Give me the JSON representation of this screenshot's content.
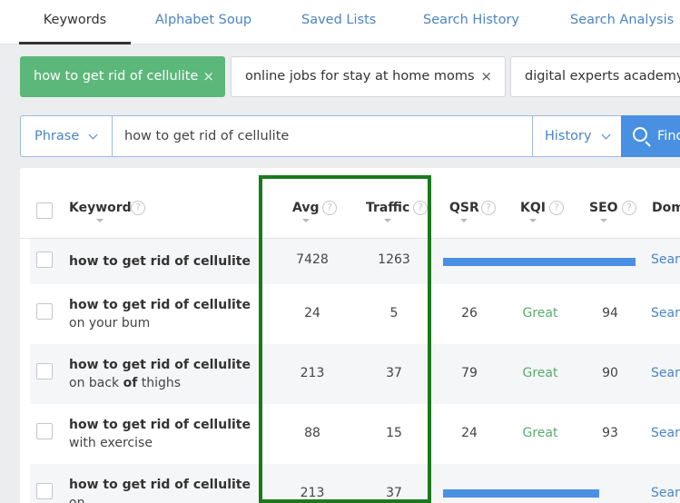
{
  "tabs": [
    {
      "label": "Keywords",
      "active": true
    },
    {
      "label": "Alphabet Soup"
    },
    {
      "label": "Saved Lists"
    },
    {
      "label": "Search History"
    },
    {
      "label": "Search Analysis"
    }
  ],
  "chips": [
    {
      "label": "how to get rid of cellulite",
      "close": "×",
      "active": true
    },
    {
      "label": "online jobs for stay at home moms",
      "close": "×"
    },
    {
      "label": "digital experts academy"
    }
  ],
  "search": {
    "mode_label": "Phrase",
    "value": "how to get rid of cellulite",
    "history_label": "History",
    "find_label": "Find"
  },
  "columns": {
    "keyword": "Keyword",
    "avg": "Avg",
    "traffic": "Traffic",
    "qsr": "QSR",
    "kqi": "KQI",
    "seo": "SEO",
    "domains": "Dom",
    "help": "?"
  },
  "rows": [
    {
      "kw_bold": "how to get rid of cellulite",
      "kw_rest": "",
      "kw_rest2": "",
      "avg": "7428",
      "traffic": "1263",
      "qsr": "",
      "kqi": "",
      "seo": "",
      "bar": 1.0,
      "link": "Search"
    },
    {
      "kw_bold": "how to get rid of cellulite",
      "kw_rest": " on your bum",
      "kw_rest2": "",
      "avg": "24",
      "traffic": "5",
      "qsr": "26",
      "kqi": "Great",
      "seo": "94",
      "link": "Search"
    },
    {
      "kw_bold": "how to get rid of cellulite",
      "kw_rest": " on back ",
      "kw_of": "of",
      "kw_rest2": " thighs",
      "avg": "213",
      "traffic": "37",
      "qsr": "79",
      "kqi": "Great",
      "seo": "90",
      "link": "Search"
    },
    {
      "kw_bold": "how to get rid of cellulite",
      "kw_rest": " with exercise",
      "kw_rest2": "",
      "avg": "88",
      "traffic": "15",
      "qsr": "24",
      "kqi": "Great",
      "seo": "93",
      "link": "Search"
    },
    {
      "kw_bold": "how to get rid of cellulite",
      "kw_rest": " on",
      "kw_rest2": "",
      "avg": "213",
      "traffic": "37",
      "qsr": "",
      "kqi": "",
      "seo": "",
      "bar": 0.81,
      "link": "Search"
    }
  ],
  "colors": {
    "accent": "#4a90e2",
    "chip_active": "#5cb77a",
    "great": "#5aac6e",
    "highlight": "#1a7a1a"
  }
}
